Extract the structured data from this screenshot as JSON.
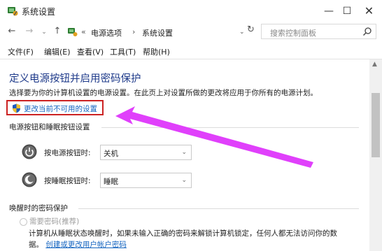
{
  "window": {
    "title": "系统设置",
    "controls": {
      "minimize": "—",
      "maximize": "☐",
      "close": "✕"
    }
  },
  "nav": {
    "back": "←",
    "forward": "→",
    "recent": "⌄",
    "up": "↑",
    "breadcrumb": {
      "overflow": "«",
      "items": [
        "电源选项",
        "系统设置"
      ],
      "separator": "›"
    },
    "dropdown": "⌄",
    "refresh": "↻",
    "search_placeholder": "搜索控制面板"
  },
  "menu": {
    "items": [
      "文件(F)",
      "编辑(E)",
      "查看(V)",
      "工具(T)",
      "帮助(H)"
    ]
  },
  "content": {
    "heading": "定义电源按钮并启用密码保护",
    "description": "选择要为你的计算机设置的电源设置。在此页上对设置所做的更改将应用于你所有的电源计划。",
    "change_settings_link": "更改当前不可用的设置",
    "power_section": {
      "title": "电源按钮和睡眠按钮设置",
      "power_button": {
        "label": "按电源按钮时:",
        "value": "关机"
      },
      "sleep_button": {
        "label": "按睡眠按钮时:",
        "value": "睡眠"
      }
    },
    "wake_section": {
      "title": "唤醒时的密码保护",
      "require_password": "需要密码(推荐)",
      "line1": "计算机从睡眠状态唤醒时，如果未输入正确的密码来解锁计算机锁定，任何人都无法访问你的数",
      "line2_prefix": "据。",
      "line2_link": "创建或更改用户帐户密码"
    }
  },
  "colors": {
    "heading": "#1e3a8a",
    "link": "#1565c0",
    "highlight_border": "#cc2222",
    "annotation_arrow": "#e040fb"
  },
  "icons": {
    "title": "control-panel-icon",
    "address": "control-panel-icon",
    "search": "search-icon",
    "shield": "uac-shield-icon",
    "power": "power-icon",
    "sleep": "moon-icon"
  }
}
